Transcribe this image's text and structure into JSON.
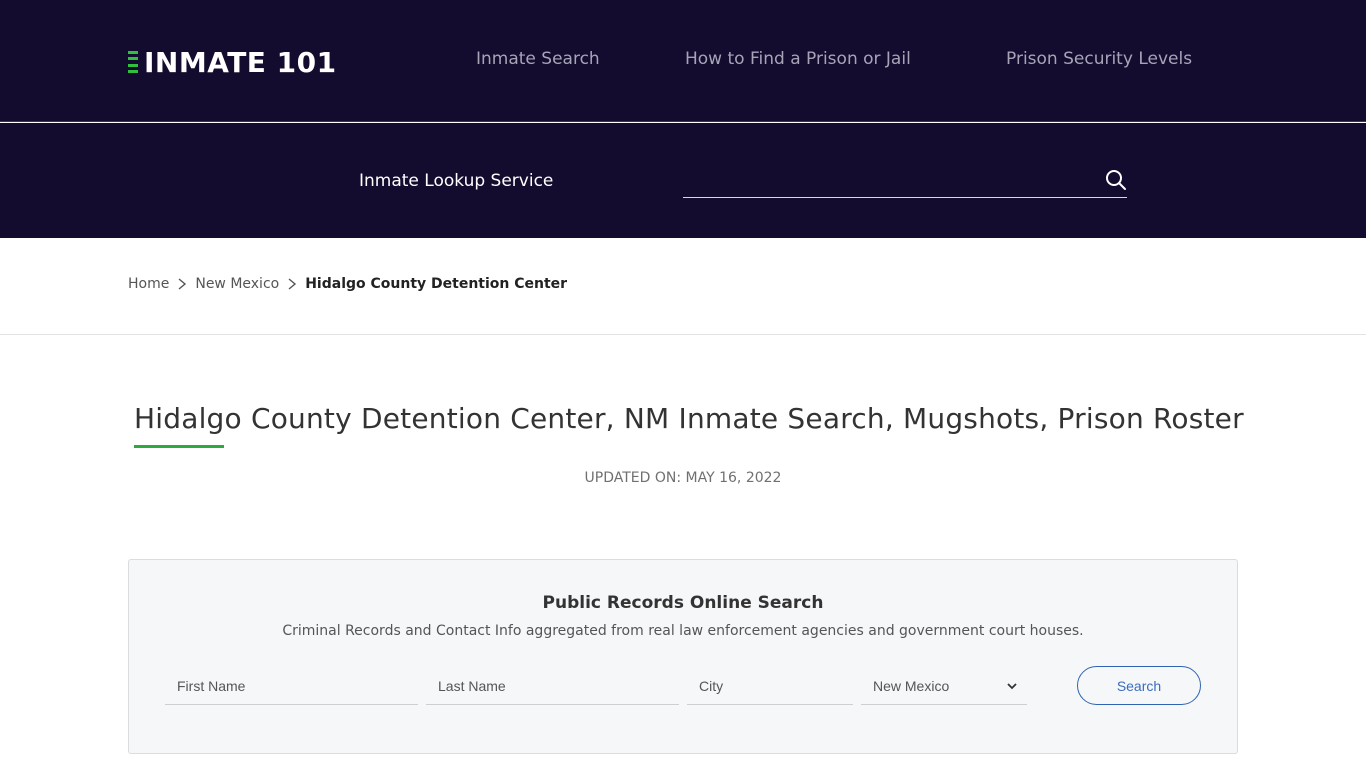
{
  "header": {
    "logo_text": "INMATE 101",
    "nav": [
      {
        "label": "Inmate Search"
      },
      {
        "label": "How to Find a Prison or Jail"
      },
      {
        "label": "Prison Security Levels"
      }
    ]
  },
  "lookup": {
    "label": "Inmate Lookup Service",
    "input_value": "",
    "input_placeholder": "",
    "icon": "search-icon"
  },
  "breadcrumb": {
    "items": [
      {
        "label": "Home"
      },
      {
        "label": "New Mexico"
      },
      {
        "label": "Hidalgo County Detention Center"
      }
    ]
  },
  "page": {
    "title": "Hidalgo County Detention Center, NM Inmate Search, Mugshots, Prison Roster",
    "updated": "UPDATED ON: MAY 16, 2022"
  },
  "search_box": {
    "title": "Public Records Online Search",
    "subtitle": "Criminal Records and Contact Info aggregated from real law enforcement agencies and government court houses.",
    "first_name_placeholder": "First Name",
    "last_name_placeholder": "Last Name",
    "city_placeholder": "City",
    "state_selected": "New Mexico",
    "search_label": "Search"
  },
  "colors": {
    "header_bg": "#130c2e",
    "accent_green": "#2fa93f",
    "button_blue": "#2f64b4"
  }
}
